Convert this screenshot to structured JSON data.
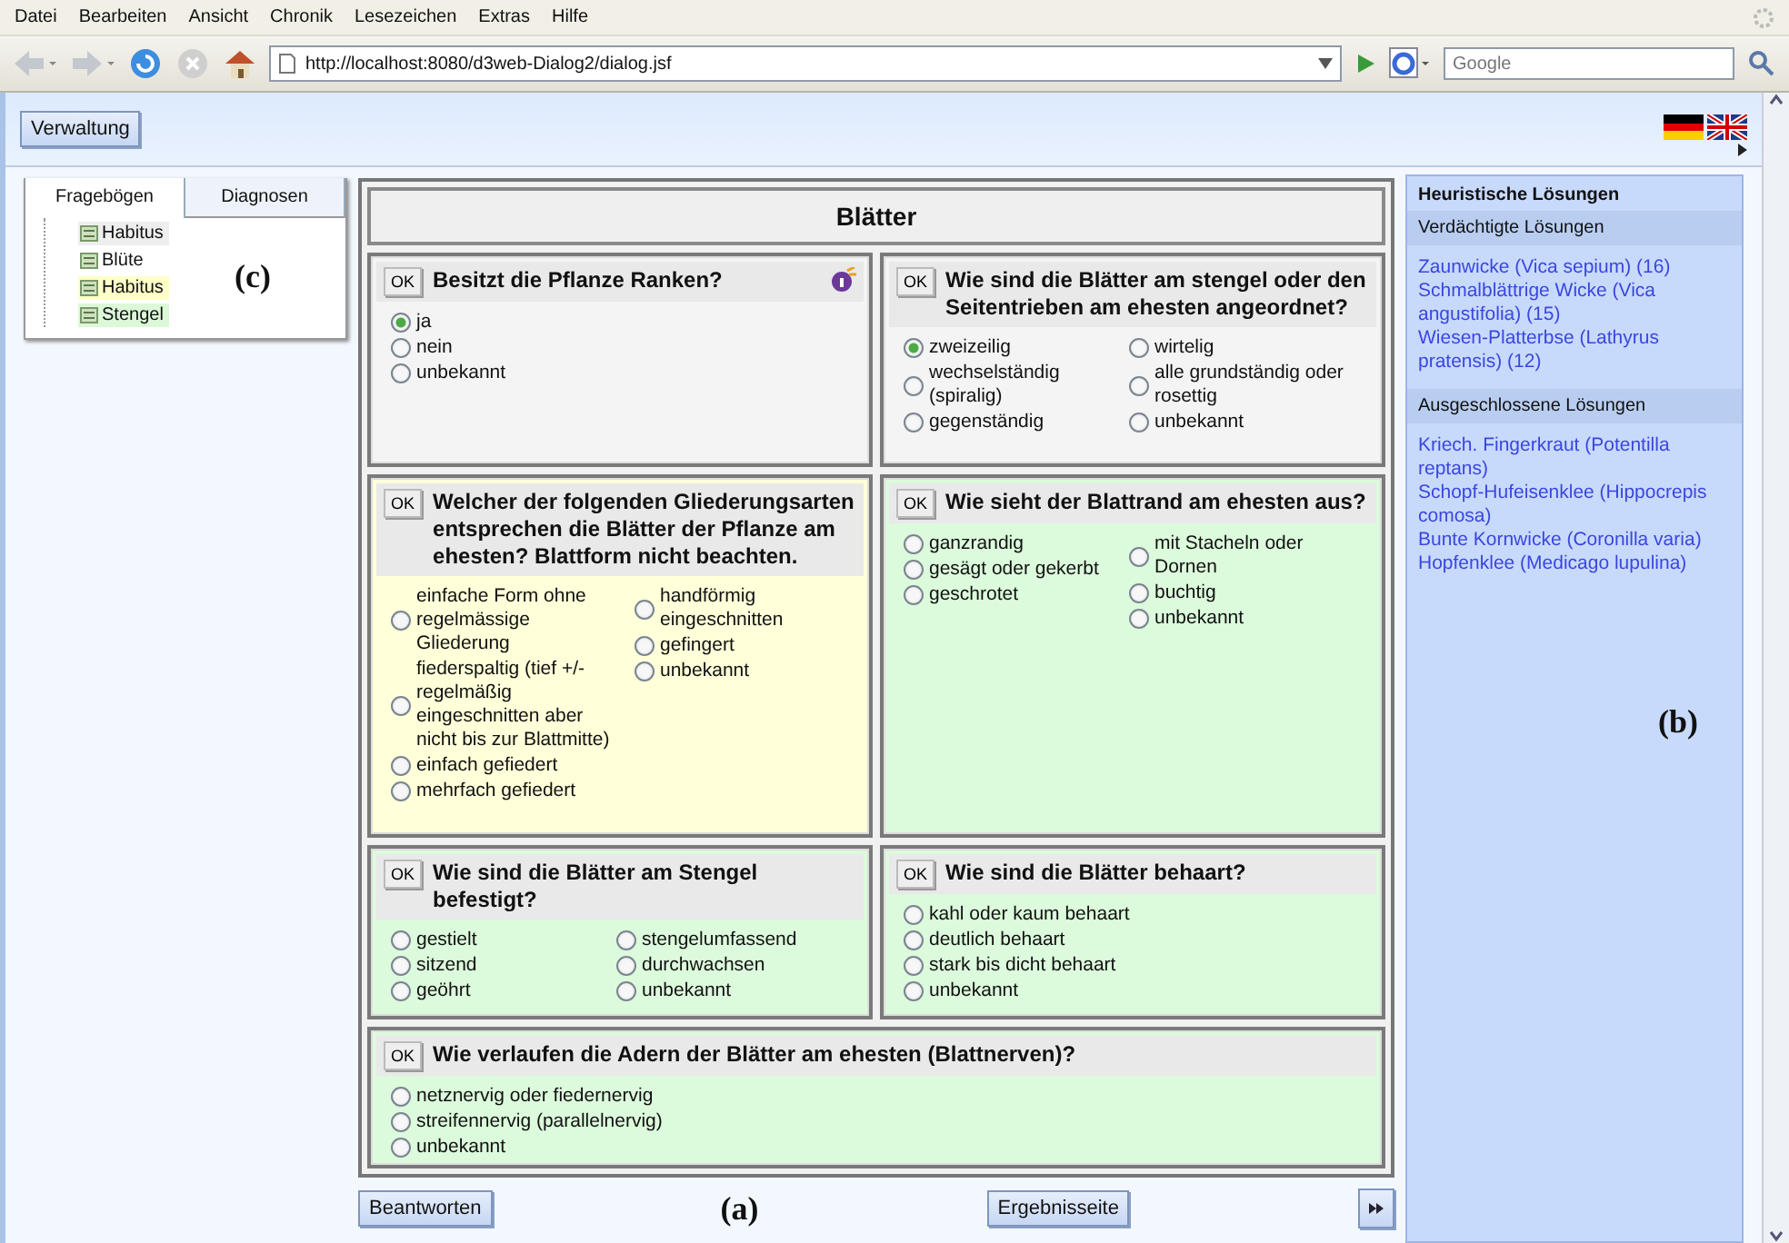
{
  "browser": {
    "menu": [
      "Datei",
      "Bearbeiten",
      "Ansicht",
      "Chronik",
      "Lesezeichen",
      "Extras",
      "Hilfe"
    ],
    "url": "http://localhost:8080/d3web-Dialog2/dialog.jsf",
    "search": {
      "placeholder": "Google"
    }
  },
  "header": {
    "button": "Verwaltung"
  },
  "navigator": {
    "tabs": [
      {
        "label": "Fragebögen",
        "selected": true
      },
      {
        "label": "Diagnosen",
        "selected": false
      }
    ],
    "items": [
      {
        "label": "Habitus",
        "color": "#eeeeee"
      },
      {
        "label": "Blüte",
        "color": "#ffffff"
      },
      {
        "label": "Habitus",
        "color": "#ffffc8"
      },
      {
        "label": "Stengel",
        "color": "#dcf8d8"
      }
    ],
    "annotation": "(c)"
  },
  "questionnaire": {
    "title": "Blätter",
    "questions": [
      {
        "ok": "OK",
        "text": "Besitzt die Pflanze Ranken?",
        "color": "#f4f4f4",
        "info": true,
        "columns": [
          [
            {
              "label": "ja",
              "selected": true
            },
            {
              "label": "nein",
              "selected": false
            },
            {
              "label": "unbekannt",
              "selected": false
            }
          ]
        ]
      },
      {
        "ok": "OK",
        "text": "Wie sind die Blätter am stengel oder den Seitentrieben am ehesten angeordnet?",
        "color": "#f4f4f4",
        "columns": [
          [
            {
              "label": "zweizeilig",
              "selected": true
            },
            {
              "label": "wechselständig (spiralig)",
              "selected": false
            },
            {
              "label": "gegenständig",
              "selected": false
            }
          ],
          [
            {
              "label": "wirtelig",
              "selected": false
            },
            {
              "label": "alle grundständig oder rosettig",
              "selected": false
            },
            {
              "label": "unbekannt",
              "selected": false
            }
          ]
        ]
      },
      {
        "ok": "OK",
        "text": "Welcher der folgenden Gliederungsarten entsprechen die Blätter der Pflanze am ehesten? Blattform nicht beachten.",
        "color": "#ffffd9",
        "columns": [
          [
            {
              "label": "einfache Form ohne regelmässige Gliederung",
              "selected": false
            },
            {
              "label": "fiederspaltig (tief +/- regelmäßig eingeschnitten aber nicht bis zur Blattmitte)",
              "selected": false
            },
            {
              "label": "einfach gefiedert",
              "selected": false
            },
            {
              "label": "mehrfach gefiedert",
              "selected": false
            }
          ],
          [
            {
              "label": "handförmig eingeschnitten",
              "selected": false
            },
            {
              "label": "gefingert",
              "selected": false
            },
            {
              "label": "unbekannt",
              "selected": false
            }
          ]
        ]
      },
      {
        "ok": "OK",
        "text": "Wie sieht der Blattrand am ehesten aus?",
        "color": "#dcfadc",
        "columns": [
          [
            {
              "label": "ganzrandig",
              "selected": false
            },
            {
              "label": "gesägt oder gekerbt",
              "selected": false
            },
            {
              "label": "geschrotet",
              "selected": false
            }
          ],
          [
            {
              "label": "mit Stacheln oder Dornen",
              "selected": false
            },
            {
              "label": "buchtig",
              "selected": false
            },
            {
              "label": "unbekannt",
              "selected": false
            }
          ]
        ]
      },
      {
        "ok": "OK",
        "text": "Wie sind die Blätter am Stengel befestigt?",
        "color": "#dcfadc",
        "columns": [
          [
            {
              "label": "gestielt",
              "selected": false
            },
            {
              "label": "sitzend",
              "selected": false
            },
            {
              "label": "geöhrt",
              "selected": false
            }
          ],
          [
            {
              "label": "stengelumfassend",
              "selected": false
            },
            {
              "label": "durchwachsen",
              "selected": false
            },
            {
              "label": "unbekannt",
              "selected": false
            }
          ]
        ]
      },
      {
        "ok": "OK",
        "text": "Wie sind die Blätter behaart?",
        "color": "#dcfadc",
        "columns": [
          [
            {
              "label": "kahl oder kaum behaart",
              "selected": false
            },
            {
              "label": "deutlich behaart",
              "selected": false
            },
            {
              "label": "stark bis dicht behaart",
              "selected": false
            },
            {
              "label": "unbekannt",
              "selected": false
            }
          ]
        ]
      },
      {
        "ok": "OK",
        "text": "Wie verlaufen die Adern der Blätter am ehesten (Blattnerven)?",
        "color": "#dcfadc",
        "columns": [
          [
            {
              "label": "netznervig oder fiedernervig",
              "selected": false
            },
            {
              "label": "streifennervig (parallelnervig)",
              "selected": false
            },
            {
              "label": "unbekannt",
              "selected": false
            }
          ]
        ]
      }
    ]
  },
  "footer": {
    "buttons": [
      "Beantworten",
      "Ergebnisseite"
    ],
    "annotation": "(a)"
  },
  "solutions": {
    "title": "Heuristische Lösungen",
    "groups": [
      {
        "title": "Verdächtigte Lösungen",
        "items": [
          "Zaunwicke (Vica sepium) (16)",
          "Schmalblättrige Wicke (Vica angustifolia) (15)",
          "Wiesen-Platterbse (Lathyrus pratensis) (12)"
        ]
      },
      {
        "title": "Ausgeschlossene Lösungen",
        "items": [
          "Kriech. Fingerkraut (Potentilla reptans)",
          "Schopf-Hufeisenklee (Hippocrepis comosa)",
          "Bunte Kornwicke (Coronilla varia)",
          "Hopfenklee (Medicago lupulina)"
        ]
      }
    ],
    "annotation": "(b)"
  }
}
